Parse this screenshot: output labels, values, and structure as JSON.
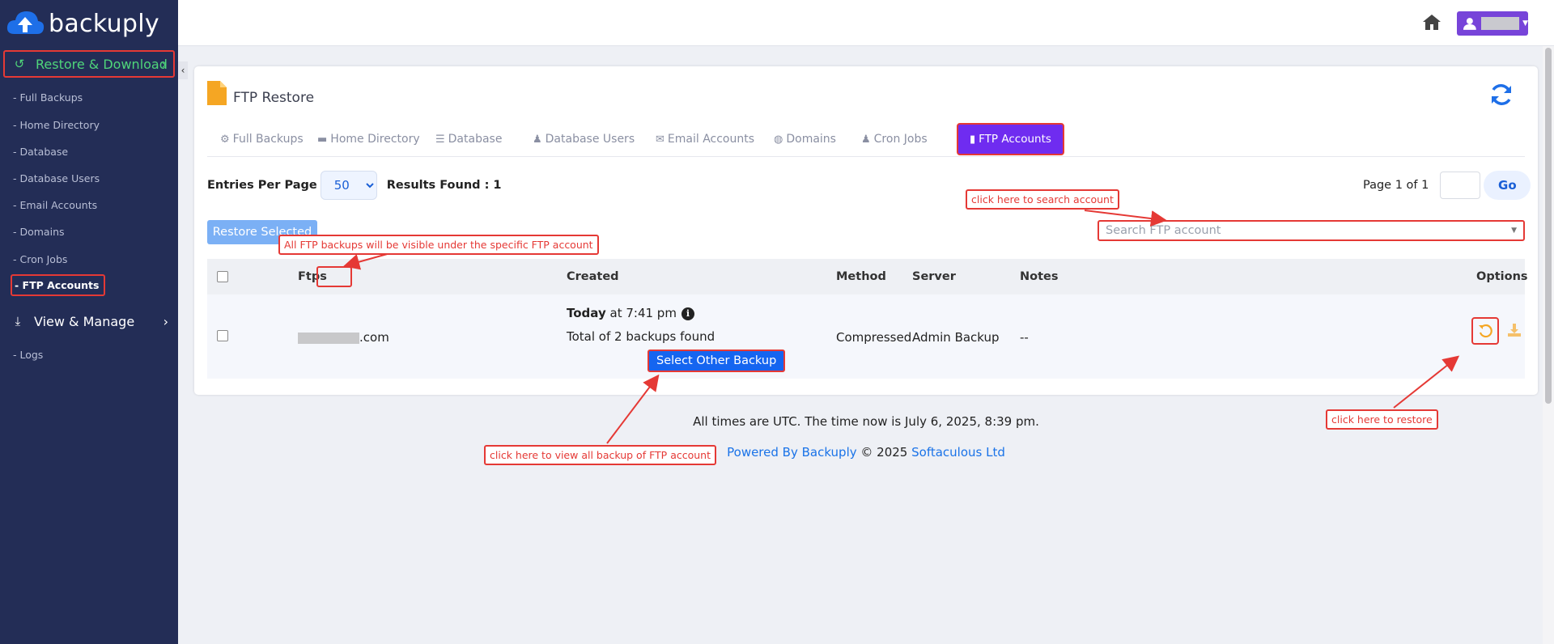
{
  "brand": {
    "name": "backuply"
  },
  "sidebar": {
    "restore_download": "Restore & Download",
    "restore_items": [
      "- Full Backups",
      "- Home Directory",
      "- Database",
      "- Database Users",
      "- Email Accounts",
      "- Domains",
      "- Cron Jobs",
      "- FTP Accounts"
    ],
    "active_item": "- FTP Accounts",
    "view_manage": "View & Manage",
    "view_items": [
      "- Logs"
    ]
  },
  "card": {
    "title": "FTP Restore",
    "tabs": [
      "Full Backups",
      "Home Directory",
      "Database",
      "Database Users",
      "Email Accounts",
      "Domains",
      "Cron Jobs",
      "FTP Accounts"
    ],
    "active_tab": "FTP Accounts",
    "entries_label": "Entries Per Page",
    "entries_value": "50",
    "results": "Results Found : 1",
    "page_info": "Page 1 of 1",
    "go_label": "Go",
    "restore_selected": "Restore Selected",
    "search_placeholder": "Search FTP account"
  },
  "table": {
    "headers": {
      "ftps": "Ftps",
      "created": "Created",
      "method": "Method",
      "server": "Server",
      "notes": "Notes",
      "options": "Options"
    },
    "row": {
      "domain_suffix": ".com",
      "created_day": "Today",
      "created_time": " at 7:41 pm",
      "backups_found": "Total of 2 backups found",
      "select_other": "Select Other Backup",
      "method": "Compressed",
      "server": "Admin Backup",
      "notes": "--"
    }
  },
  "footer": {
    "time_note": "All times are UTC. The time now is July 6, 2025, 8:39 pm.",
    "powered": "Powered By Backuply",
    "copyright": " © 2025 ",
    "company": "Softaculous Ltd"
  },
  "annotations": {
    "search": "click here to search account",
    "ftps": "All FTP backups will be visible under the specific FTP account",
    "select_other": "click here to view all backup of FTP account",
    "restore": "click here to restore"
  },
  "colors": {
    "sidebar_bg": "#232d56",
    "accent_purple": "#6f2cf0",
    "primary_blue": "#1565f0",
    "annotation_red": "#e53935",
    "restore_green": "#4fd57a",
    "icon_orange": "#f5a623"
  }
}
